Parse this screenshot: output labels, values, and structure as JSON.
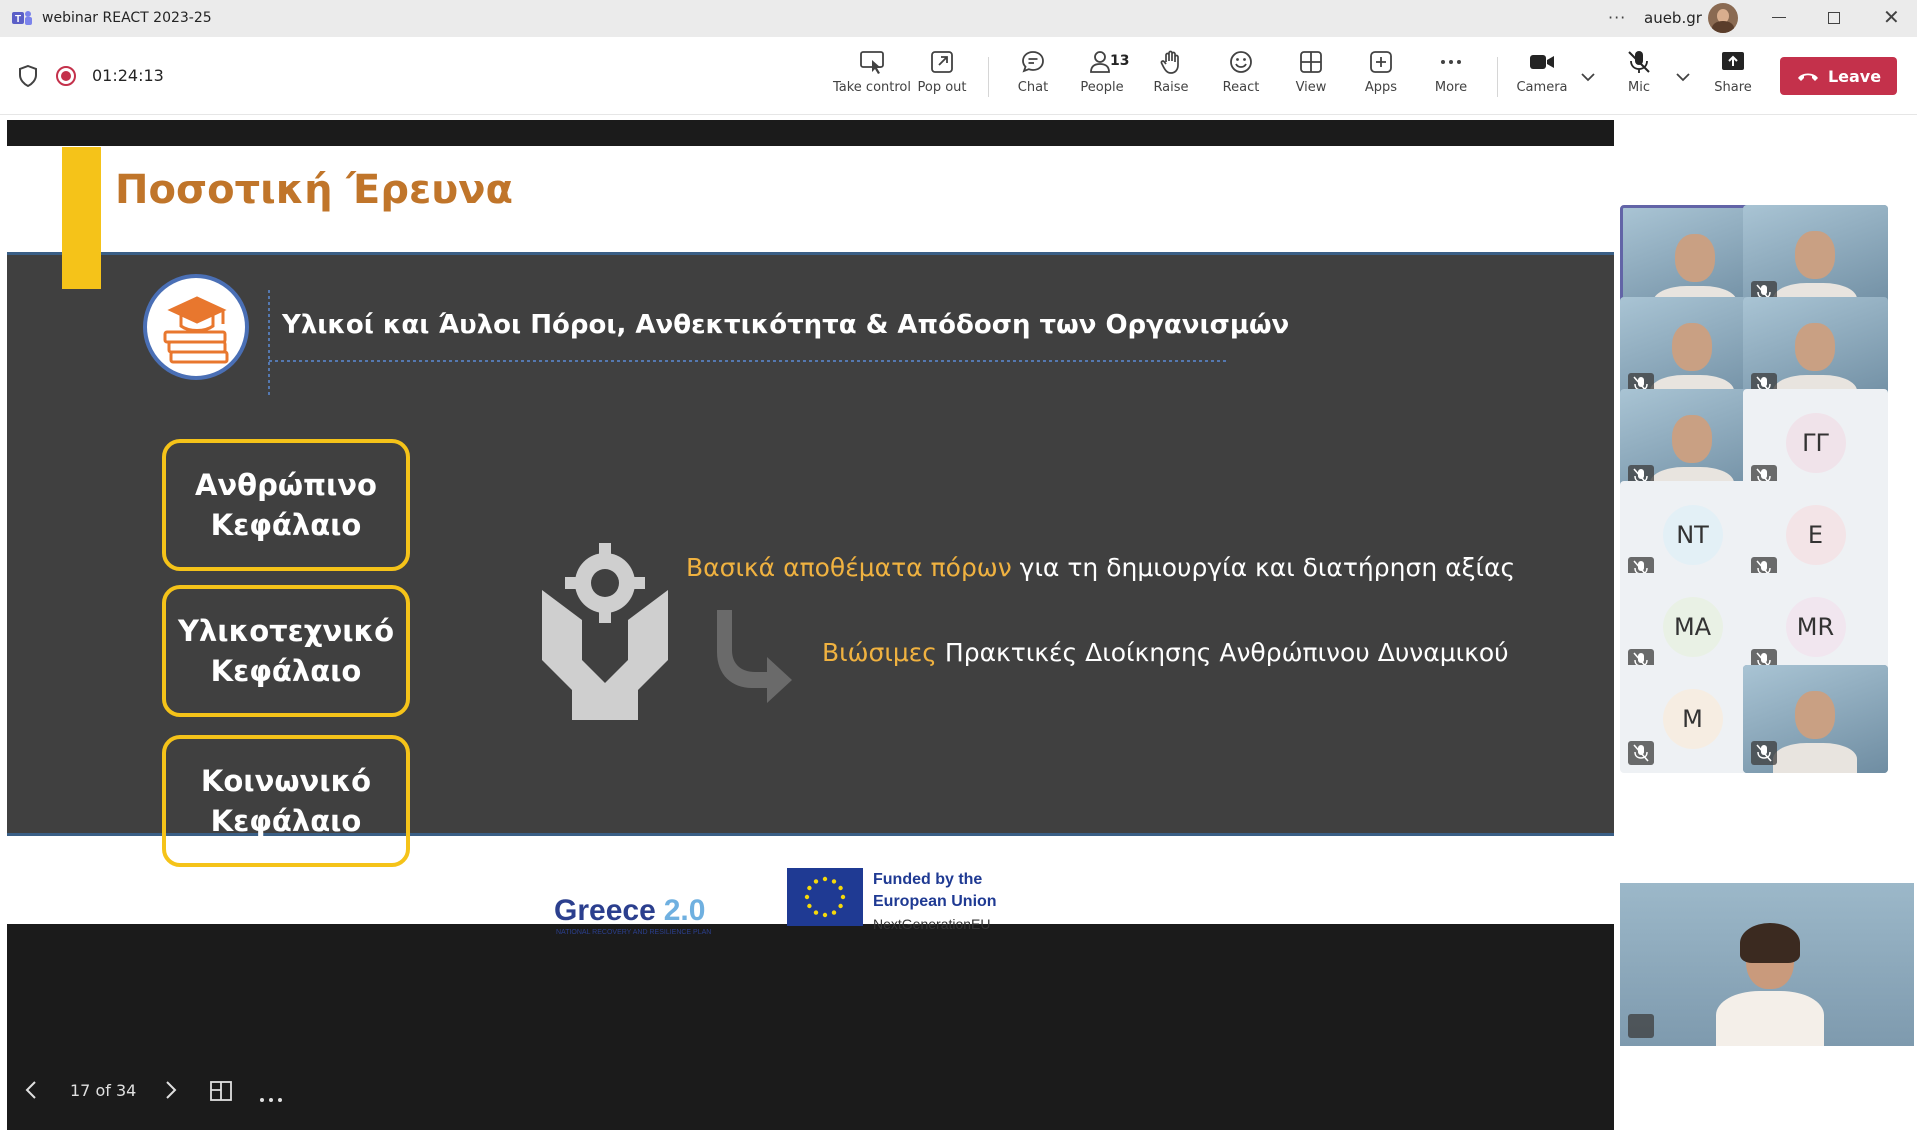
{
  "window": {
    "title": "webinar REACT 2023-25",
    "account": "aueb.gr",
    "more_label": "···"
  },
  "meeting": {
    "timer": "01:24:13",
    "people_count": "13",
    "leave_label": "Leave"
  },
  "toolbar": {
    "take_control": "Take control",
    "pop_out": "Pop out",
    "chat": "Chat",
    "people": "People",
    "raise": "Raise",
    "react": "React",
    "view": "View",
    "apps": "Apps",
    "more": "More",
    "camera": "Camera",
    "mic": "Mic",
    "share": "Share"
  },
  "slide": {
    "title": "Ποσοτική Έρευνα",
    "subtitle": "Υλικοί και Άυλοι Πόροι, Ανθεκτικότητα & Απόδοση των Οργανισμών",
    "capitals": [
      {
        "line1": "Ανθρώπινο",
        "line2": "Κεφάλαιο"
      },
      {
        "line1": "Υλικοτεχνικό",
        "line2": "Κεφάλαιο"
      },
      {
        "line1": "Κοινωνικό",
        "line2": "Κεφάλαιο"
      }
    ],
    "line1_highlight": "Βασικά αποθέματα πόρων",
    "line1_rest": "για τη δημιουργία και διατήρηση αξίας",
    "line2_highlight": "Βιώσιμες",
    "line2_rest": "Πρακτικές Διοίκησης Ανθρώπινου Δυναμικού",
    "footer_greece_word": "Greece",
    "footer_greece_version": "2.0",
    "footer_greece_tagline": "NATIONAL RECOVERY AND RESILIENCE PLAN",
    "footer_eu_line1": "Funded by the",
    "footer_eu_line2": "European Union",
    "footer_eu_line3": "NextGenerationEU"
  },
  "slide_nav": {
    "position": "17 of 34"
  },
  "participants": [
    {
      "initials": "",
      "video": true
    },
    {
      "initials": "",
      "video": true
    },
    {
      "initials": "",
      "video": true
    },
    {
      "initials": "",
      "video": true
    },
    {
      "initials": "",
      "video": true
    },
    {
      "initials": "ΓΓ",
      "video": false
    },
    {
      "initials": "NT",
      "video": false
    },
    {
      "initials": "E",
      "video": false
    },
    {
      "initials": "MA",
      "video": false
    },
    {
      "initials": "MR",
      "video": false
    },
    {
      "initials": "M",
      "video": false
    },
    {
      "initials": "",
      "video": true
    }
  ],
  "colors": {
    "accent_yellow": "#f5c319",
    "title_orange": "#c0752a",
    "highlight_orange": "#f0b240",
    "leave_red": "#c4314b",
    "slide_gray": "#404040"
  }
}
